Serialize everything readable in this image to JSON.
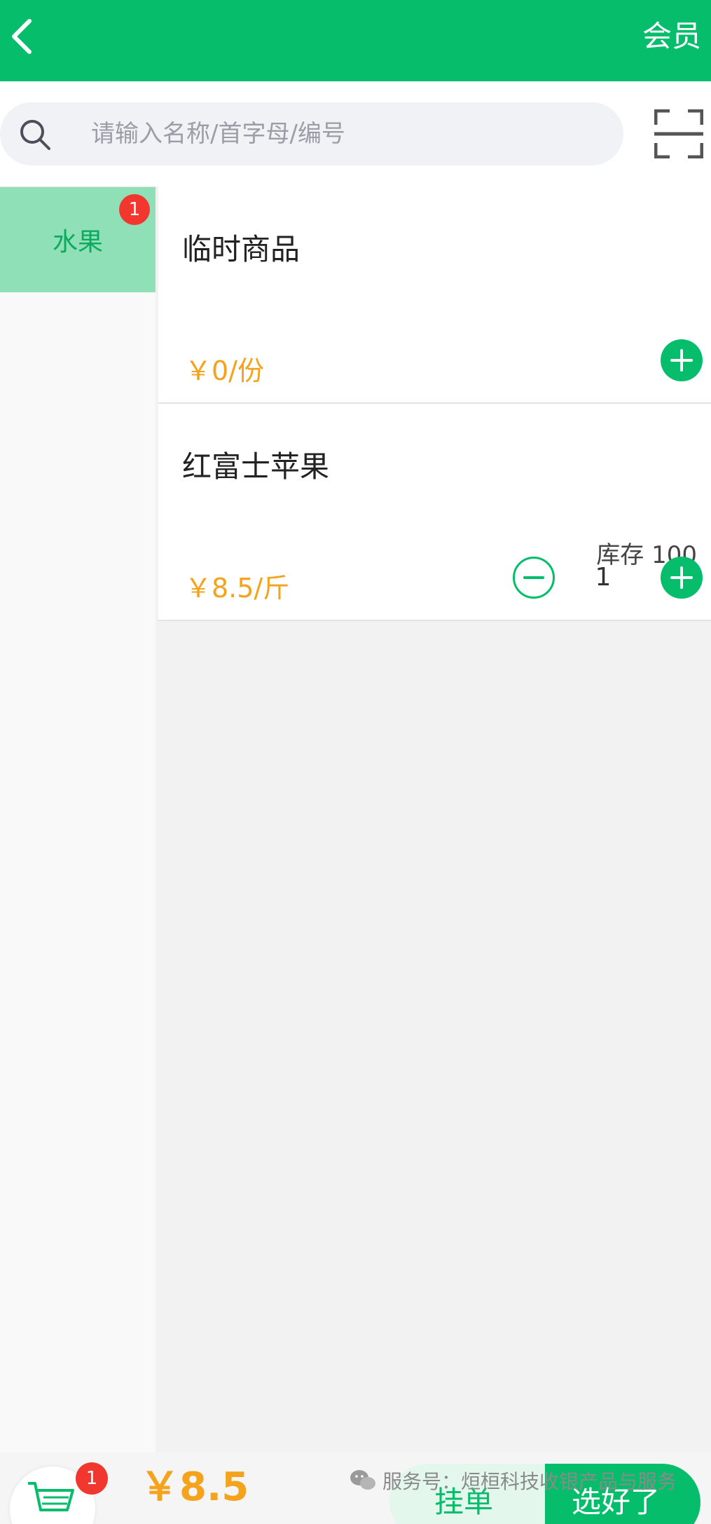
{
  "header": {
    "member_label": "会员"
  },
  "search": {
    "placeholder": "请输入名称/首字母/编号"
  },
  "sidebar": {
    "categories": [
      {
        "label": "水果",
        "badge": "1"
      }
    ]
  },
  "products": [
    {
      "name": "临时商品",
      "price": "￥0/份"
    },
    {
      "name": "红富士苹果",
      "price": "￥8.5/斤",
      "stock": "库存 100",
      "quantity": "1"
    }
  ],
  "footer": {
    "cart_badge": "1",
    "total": "￥8.5",
    "hold_label": "挂单",
    "done_label": "选好了",
    "watermark": "服务号：烜桓科技收银产品与服务"
  },
  "colors": {
    "accent": "#05bd6b",
    "price": "#f5a21c",
    "badge": "#f2372f"
  }
}
